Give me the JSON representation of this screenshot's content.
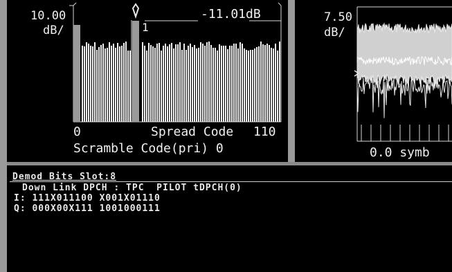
{
  "left_panel": {
    "scale_value": "10.00",
    "scale_unit": "dB/",
    "marker_readout": "-11.01dB",
    "marker_number": "1",
    "x_start": "0",
    "x_title": "Spread Code",
    "x_end": "110",
    "scramble_label": "Scramble Code(pri) 0"
  },
  "right_panel": {
    "scale_value": "7.50",
    "scale_unit": "dB/",
    "x_readout": "0.0 symb"
  },
  "demod": {
    "title": "Demod Bits  Slot:8",
    "header": "Down Link DPCH : TPC  PILOT tDPCH(0)",
    "i_line": "I: 111X011100 X001X01110",
    "q_line": "Q: 000X00X111 1001000111"
  },
  "colors": {
    "background": "#000000",
    "trace": "#f0f0f0",
    "marker_bar": "#9a9a9a",
    "divider": "#9a9a9a"
  }
}
